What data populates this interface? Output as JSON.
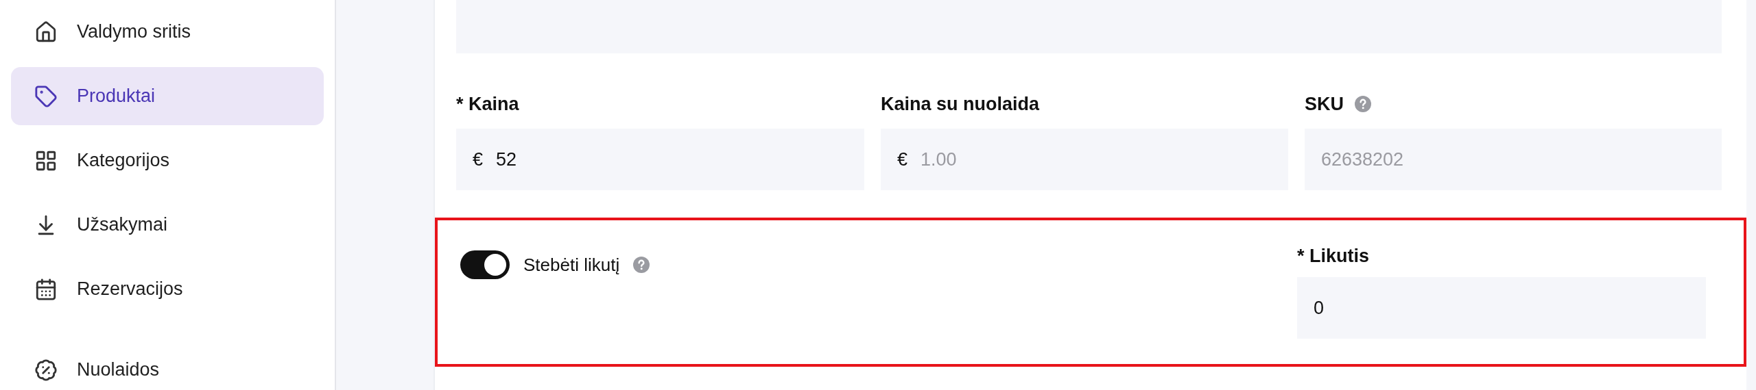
{
  "sidebar": {
    "items": [
      {
        "label": "Valdymo sritis",
        "selected": false
      },
      {
        "label": "Produktai",
        "selected": true
      },
      {
        "label": "Kategorijos",
        "selected": false
      },
      {
        "label": "Užsakymai",
        "selected": false
      },
      {
        "label": "Rezervacijos",
        "selected": false
      }
    ],
    "secondary_items": [
      {
        "label": "Nuolaidos",
        "selected": false
      }
    ]
  },
  "form": {
    "price_fields": [
      {
        "label": "* Kaina",
        "prefix": "€",
        "value": "52"
      },
      {
        "label": "Kaina su nuolaida",
        "prefix": "€",
        "placeholder": "1.00"
      },
      {
        "label": "SKU",
        "help": true,
        "placeholder": "62638202"
      }
    ],
    "stock": {
      "toggle": {
        "label": "Stebėti likutį",
        "on": true,
        "help": true
      },
      "field": {
        "label": "* Likutis",
        "value": "0"
      }
    }
  }
}
